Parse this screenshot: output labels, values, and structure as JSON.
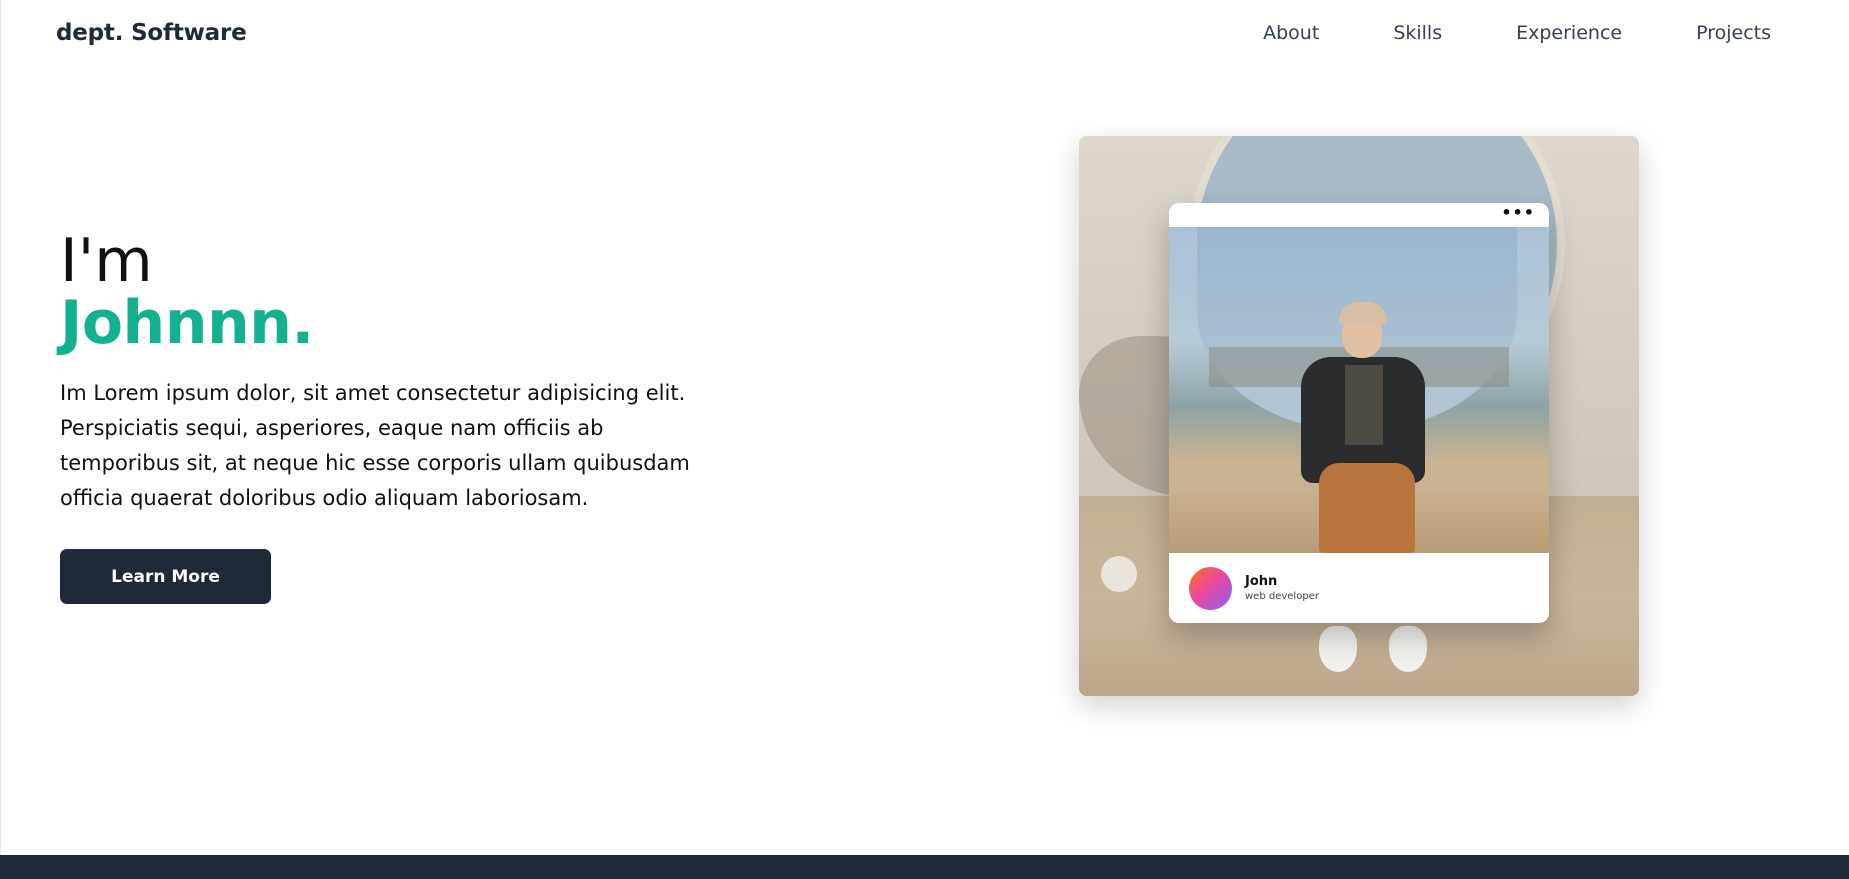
{
  "header": {
    "brand": "dept. Software",
    "nav": [
      "About",
      "Skills",
      "Experience",
      "Projects"
    ]
  },
  "hero": {
    "greeting": "I'm",
    "name": "Johnnn.",
    "bio": "Im Lorem ipsum dolor, sit amet consectetur adipisicing elit. Perspiciatis sequi, asperiores, eaque nam officiis ab temporibus sit, at neque hic esse corporis ullam quibusdam officia quaerat doloribus odio aliquam laboriosam.",
    "cta_label": "Learn More"
  },
  "profile_card": {
    "menu_glyph": "•••",
    "name": "John",
    "role": "web developer"
  },
  "colors": {
    "accent": "#14b190",
    "dark": "#1f2937"
  }
}
